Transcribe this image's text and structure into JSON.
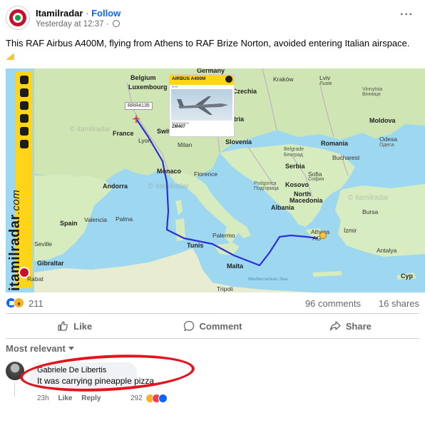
{
  "post": {
    "author": "Itamilradar",
    "separator": "·",
    "follow_label": "Follow",
    "timestamp": "Yesterday at 12:37 ·",
    "more_label": "···",
    "text": "This RAF Airbus A400M, flying from Athens to RAF Brize Norton, avoided entering Italian airspace."
  },
  "map": {
    "brand": "itamilradar",
    "brand_suffix": ".com",
    "flight_label": "RRR4135",
    "card_title": "AIRBUS A400M",
    "card_subtitle": "RAF",
    "card_reg_label": "Registration",
    "card_reg_value": "ZM407",
    "watermark": "© itamilradar",
    "places": {
      "germany": "Germany",
      "belgium": "Belgium",
      "luxembourg": "Luxembourg",
      "czechia": "Czechia",
      "lviv": "Lviv",
      "lviv_local": "Львів",
      "krakow": "Kraków",
      "vinnytsia": "Vinnytsia",
      "vinnytsia_local": "Вінниця",
      "moldova": "Moldova",
      "odesa": "Odesa",
      "odesa_local": "Одеса",
      "france": "France",
      "lyon": "Lyon",
      "switzerland": "Swit",
      "milan": "Milan",
      "austria": "tria",
      "slovenia": "Slovenia",
      "romania": "Romania",
      "belgrade": "Belgrade",
      "belgrade_local": "Београд",
      "bucharest": "Bucharest",
      "monaco": "Monaco",
      "florence": "Florence",
      "serbia": "Serbia",
      "sofia": "Sofia",
      "sofia_local": "София",
      "andorra": "Andorra",
      "podgorica": "Podgorica",
      "podgorica_local": "Подгорица",
      "kosovo": "Kosovo",
      "north_macedonia": "North",
      "north_macedonia_2": "Macedonia",
      "albania": "Albania",
      "spain": "Spain",
      "valencia": "Valencia",
      "palma": "Palma",
      "bursa": "Bursa",
      "seville": "Seville",
      "tunis": "Tunis",
      "palermo": "Palermo",
      "athens": "Athens",
      "athens_2": "AG",
      "izmir": "İzmir",
      "antalya": "Antalya",
      "gibraltar": "Gibraltar",
      "malta": "Malta",
      "rabat": "Rabat",
      "tripoli": "Tripoli",
      "cyprus": "Cyp",
      "med_sea": "Mediterranean Sea"
    }
  },
  "stats": {
    "reactions_count": "211",
    "comments": "96 comments",
    "shares": "16 shares"
  },
  "actions": {
    "like": "Like",
    "comment": "Comment",
    "share": "Share"
  },
  "sort_label": "Most relevant",
  "comment": {
    "author": "Gabriele De Libertis",
    "text": "It was carrying pineapple pizza",
    "age": "23h",
    "like": "Like",
    "reply": "Reply",
    "reactions": "292"
  },
  "colors": {
    "brand_yellow": "#ffd51a",
    "fb_blue": "#0866ff",
    "route": "#2a2fd6",
    "highlight_red": "#e2141d"
  }
}
